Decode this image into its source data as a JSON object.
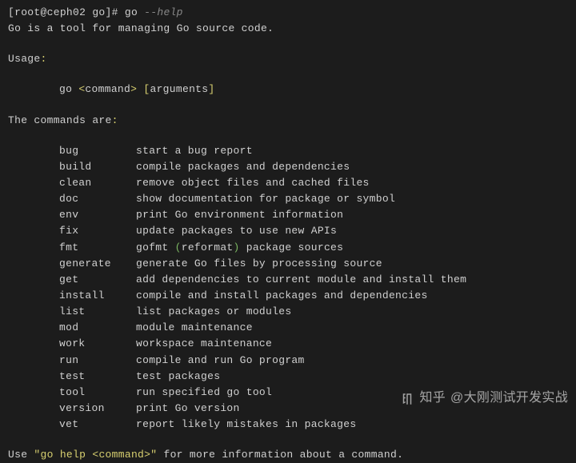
{
  "prompt": {
    "open_bracket": "[",
    "user_host": "root@ceph02",
    "cwd": " go",
    "close_bracket": "]",
    "hash": "# ",
    "command": "go ",
    "flag": "--help"
  },
  "intro": "Go is a tool for managing Go source code.",
  "usage_label": "Usage",
  "usage_colon": ":",
  "syntax": {
    "cmd": "go ",
    "lt1": "<",
    "arg1": "command",
    "gt1": ">",
    "space": " ",
    "lb": "[",
    "arg2": "arguments",
    "rb": "]"
  },
  "commands_header": "The commands are",
  "commands_colon": ":",
  "commands": [
    {
      "name": "bug",
      "desc": "start a bug report"
    },
    {
      "name": "build",
      "desc": "compile packages and dependencies"
    },
    {
      "name": "clean",
      "desc": "remove object files and cached files"
    },
    {
      "name": "doc",
      "desc": "show documentation for package or symbol"
    },
    {
      "name": "env",
      "desc": "print Go environment information"
    },
    {
      "name": "fix",
      "desc": "update packages to use new APIs"
    },
    {
      "name": "fmt",
      "desc_pre": "gofmt ",
      "paren_open": "(",
      "desc_mid": "reformat",
      "paren_close": ")",
      "desc_post": " package sources"
    },
    {
      "name": "generate",
      "desc": "generate Go files by processing source"
    },
    {
      "name": "get",
      "desc": "add dependencies to current module and install them"
    },
    {
      "name": "install",
      "desc": "compile and install packages and dependencies"
    },
    {
      "name": "list",
      "desc": "list packages or modules"
    },
    {
      "name": "mod",
      "desc": "module maintenance"
    },
    {
      "name": "work",
      "desc": "workspace maintenance"
    },
    {
      "name": "run",
      "desc": "compile and run Go program"
    },
    {
      "name": "test",
      "desc": "test packages"
    },
    {
      "name": "tool",
      "desc": "run specified go tool"
    },
    {
      "name": "version",
      "desc": "print Go version"
    },
    {
      "name": "vet",
      "desc": "report likely mistakes in packages"
    }
  ],
  "footer": {
    "pre": "Use ",
    "quote_open": "\"",
    "help_cmd_pre": "go help ",
    "lt": "<",
    "help_arg": "command",
    "gt": ">",
    "quote_close": "\"",
    "post": " for more information about a command."
  },
  "watermark": {
    "brand": "知乎",
    "author": "@大刚测试开发实战"
  }
}
